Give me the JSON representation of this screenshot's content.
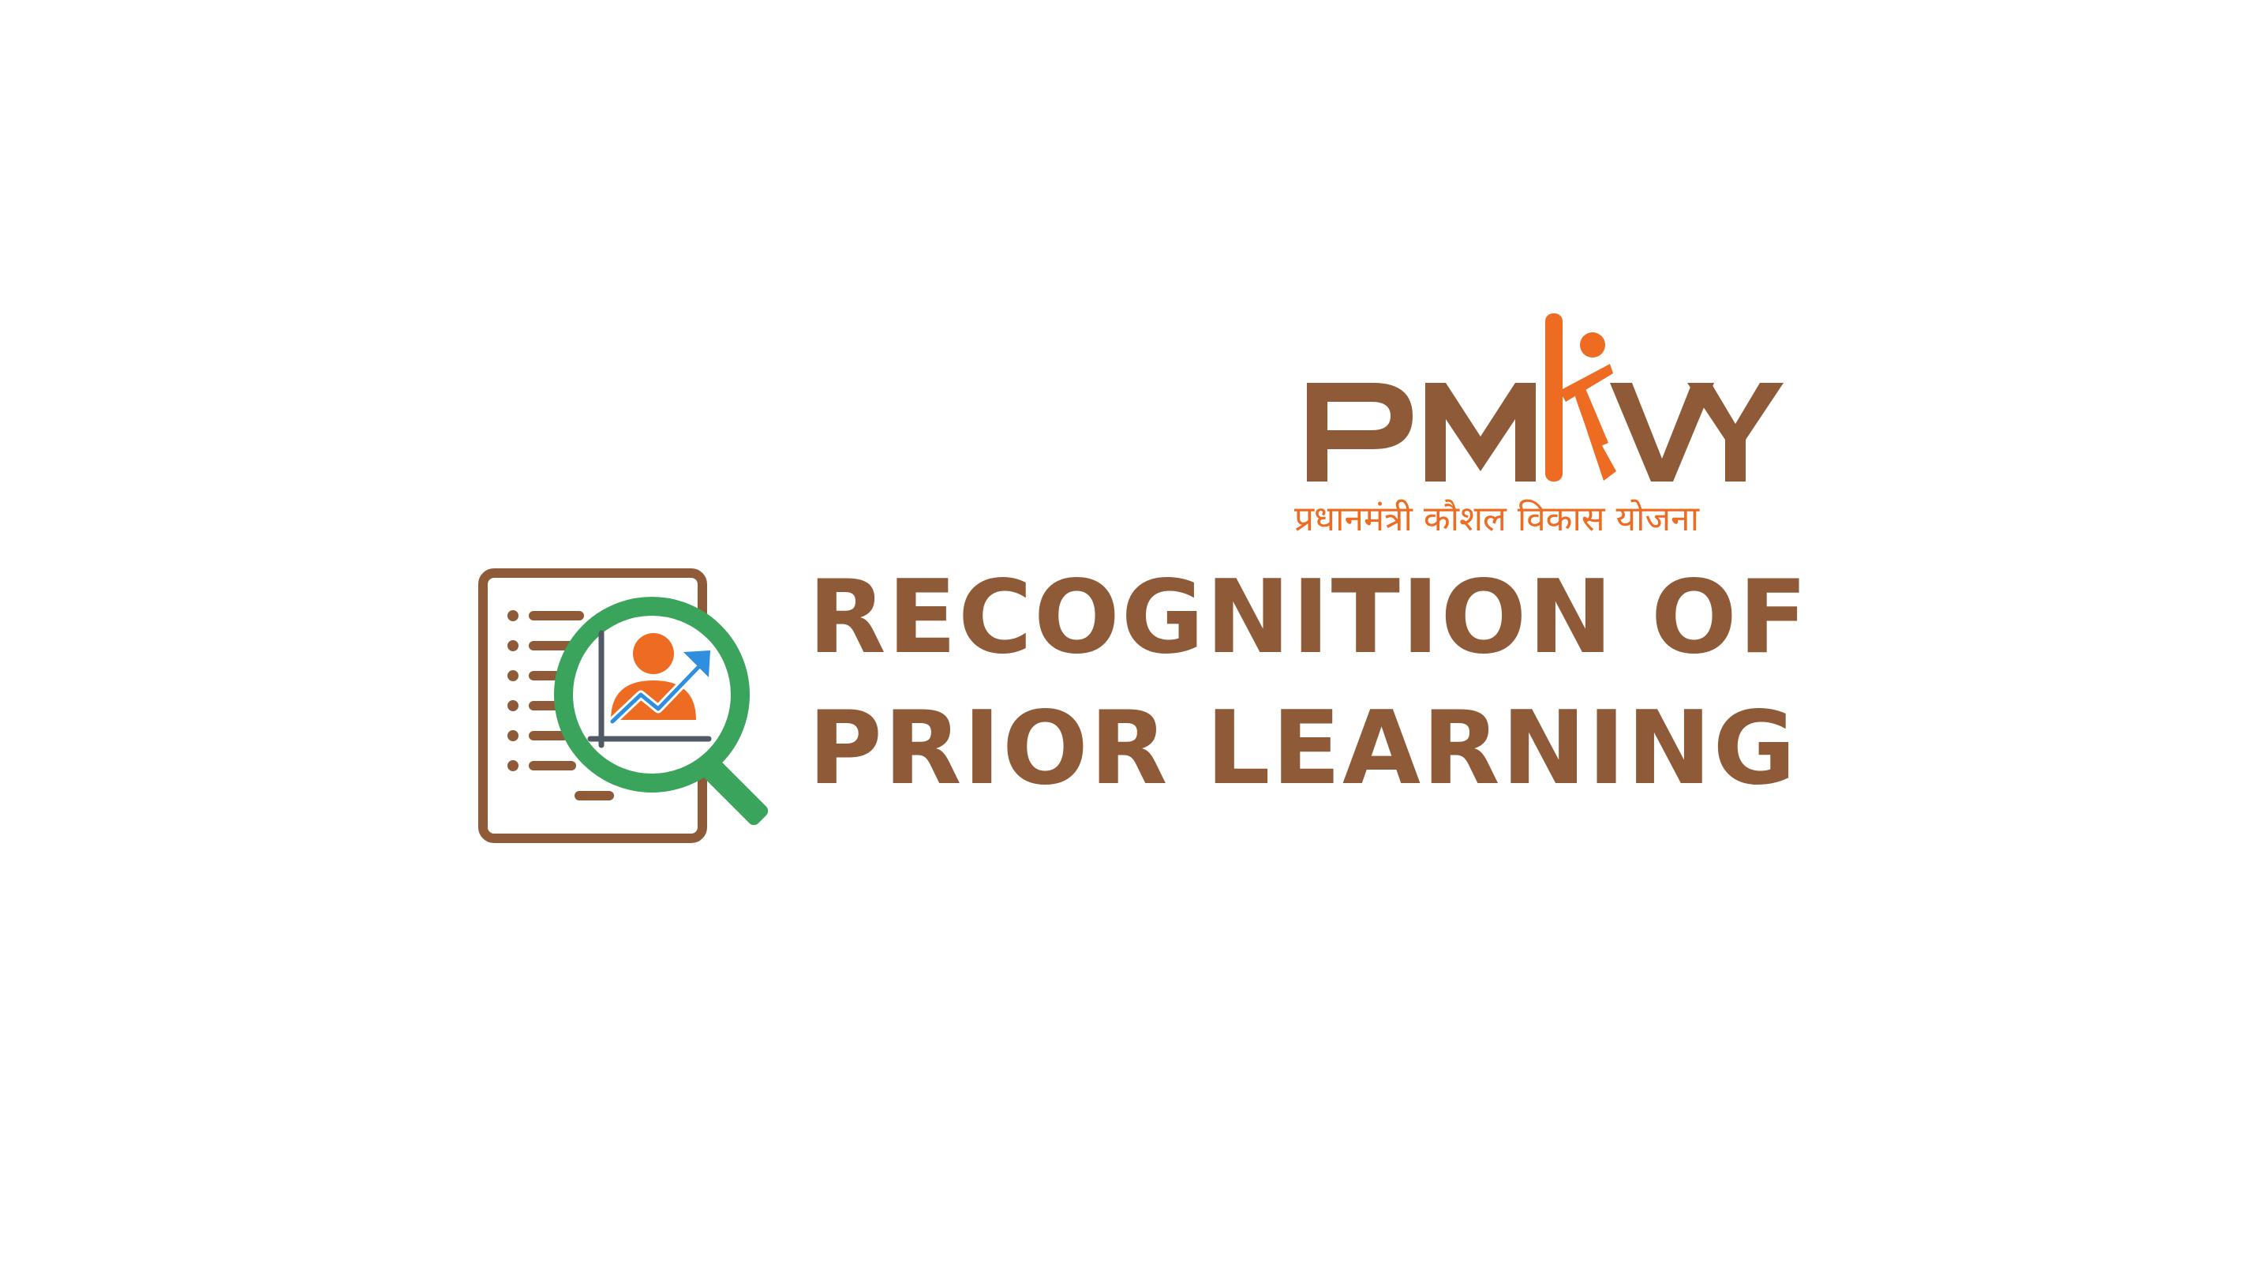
{
  "logo": {
    "brand_left": "PM",
    "brand_right": "VY",
    "tagline": "प्रधानमंत्री कौशल विकास योजना",
    "colors": {
      "brown": "#8f5a37",
      "orange": "#ee6b22"
    }
  },
  "headline": {
    "line1": "RECOGNITION OF",
    "line2": "PRIOR LEARNING"
  },
  "icons": {
    "document": "document-list-icon",
    "magnifier": "magnifying-glass-icon",
    "person": "person-growth-icon"
  },
  "colors": {
    "brown": "#8f5a37",
    "green": "#3aa35c",
    "orange": "#ee6b22",
    "blue": "#2f8ee0",
    "slate": "#4f5a64"
  }
}
